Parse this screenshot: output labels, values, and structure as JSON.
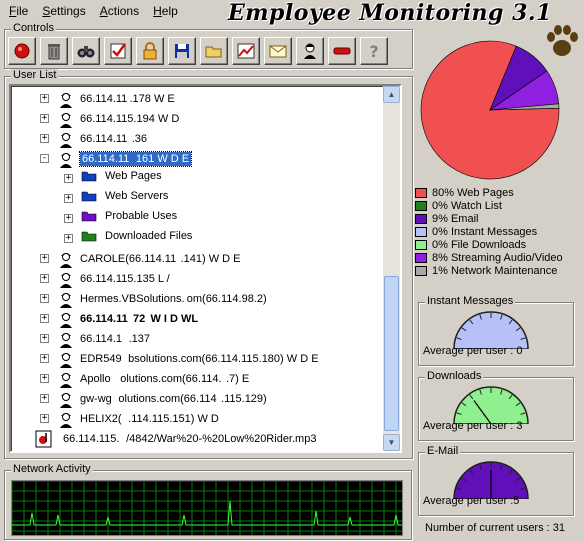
{
  "app": {
    "title": "Employee Monitoring 3.1"
  },
  "menu": [
    {
      "label": "File",
      "accel": "F",
      "rest": "ile"
    },
    {
      "label": "Settings",
      "accel": "S",
      "rest": "ettings"
    },
    {
      "label": "Actions",
      "accel": "A",
      "rest": "ctions"
    },
    {
      "label": "Help",
      "accel": "H",
      "rest": "elp"
    }
  ],
  "controls": {
    "label": "Controls",
    "buttons": [
      "record-icon",
      "trash-icon",
      "binoculars-icon",
      "checklist-icon",
      "lock-icon",
      "save-icon",
      "open-folder-icon",
      "chart-icon",
      "mail-icon",
      "user-icon",
      "stop-icon",
      "help-icon"
    ]
  },
  "user_list": {
    "label": "User List",
    "rows": [
      {
        "text": "66.114.11 .178  W E",
        "kind": "person",
        "expander": "+",
        "level": 0
      },
      {
        "text": "66.114.115.194  W D",
        "kind": "person",
        "expander": "+",
        "level": 0
      },
      {
        "text": "66.114.11  .36",
        "kind": "person",
        "expander": "+",
        "level": 0
      },
      {
        "text": "66.114.11   161  W D E",
        "kind": "person",
        "expander": "-",
        "level": 0,
        "selected": true
      },
      {
        "text": "Web Pages",
        "kind": "folder-blue",
        "expander": "+",
        "level": 1
      },
      {
        "text": "Web Servers",
        "kind": "folder-blue",
        "expander": "+",
        "level": 1
      },
      {
        "text": "Probable Uses",
        "kind": "folder-purple",
        "expander": "+",
        "level": 1
      },
      {
        "text": "Downloaded Files",
        "kind": "folder-green",
        "expander": "+",
        "level": 1
      },
      {
        "text": "CAROLE(66.114.11  .141)  W D E",
        "kind": "person",
        "expander": "+",
        "level": 0
      },
      {
        "text": "66.114.115.135  L  /",
        "kind": "person",
        "expander": "+",
        "level": 0
      },
      {
        "text": "Hermes.VBSolutions. om(66.114.98.2)",
        "kind": "person",
        "expander": "+",
        "level": 0
      },
      {
        "text": "66.114.11   72   W I D WL",
        "kind": "person",
        "expander": "+",
        "level": 0,
        "bold": true
      },
      {
        "text": "66.114.1   .137",
        "kind": "person",
        "expander": "+",
        "level": 0
      },
      {
        "text": "EDR549   bsolutions.com(66.114.115.180)  W D E",
        "kind": "person",
        "expander": "+",
        "level": 0
      },
      {
        "text": "Apollo     olutions.com(66.114.  .7)  E",
        "kind": "person",
        "expander": "+",
        "level": 0
      },
      {
        "text": "gw-wg   olutions.com(66.114  .115.129)",
        "kind": "person",
        "expander": "+",
        "level": 0
      },
      {
        "text": "HELIX2(   .114.115.151)  W D",
        "kind": "person",
        "expander": "+",
        "level": 0
      },
      {
        "text": "66.114.115.   /4842/War%20-%20Low%20Rider.mp3",
        "kind": "music",
        "expander": "",
        "level": 0
      }
    ]
  },
  "network": {
    "label": "Network Activity"
  },
  "chart_data": {
    "type": "pie",
    "legend_placement": "bottom",
    "slices": [
      {
        "label": "80% Web Pages",
        "value": 80,
        "color": "#f05050"
      },
      {
        "label": "0% Watch List",
        "value": 0,
        "color": "#208020"
      },
      {
        "label": "9% Email",
        "value": 9,
        "color": "#6010b8"
      },
      {
        "label": "0% Instant Messages",
        "value": 0,
        "color": "#b8c0f8"
      },
      {
        "label": "0% File Downloads",
        "value": 0,
        "color": "#90f090"
      },
      {
        "label": "8% Streaming Audio/Video",
        "value": 8,
        "color": "#9020e0"
      },
      {
        "label": "1% Network Maintenance",
        "value": 1,
        "color": "#a8a8a8"
      }
    ]
  },
  "gauges": [
    {
      "label": "Instant Messages",
      "caption": "Average per user : 0",
      "value": 0,
      "color": "#b8c0f8"
    },
    {
      "label": "Downloads",
      "caption": "Average per user : 3",
      "value": 3,
      "color": "#90f090"
    },
    {
      "label": "E-Mail",
      "caption": "Average per user :5",
      "value": 5,
      "color": "#6010b8"
    }
  ],
  "status": {
    "users_count": "Number of current users : 31"
  }
}
